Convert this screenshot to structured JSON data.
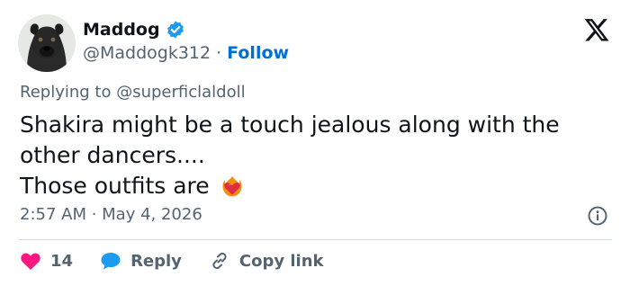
{
  "author": {
    "display_name": "Maddog",
    "handle": "@Maddogk312",
    "separator": "·",
    "follow_label": "Follow"
  },
  "tweet": {
    "replying_prefix": "Replying to",
    "replying_to": "@superficlaldoll",
    "line1": "Shakira might be a touch jealous along with the",
    "line2": "other dancers....",
    "line3": "Those outfits are",
    "emoji": "heart-on-fire-icon",
    "timestamp": "2:57 AM · May 4, 2026"
  },
  "actions": {
    "like_count": "14",
    "reply_label": "Reply",
    "copy_label": "Copy link"
  },
  "colors": {
    "verified": "#1d9bf0",
    "link": "#006fd6",
    "like": "#f91880",
    "reply": "#1d9bf0",
    "muted": "#536471"
  }
}
